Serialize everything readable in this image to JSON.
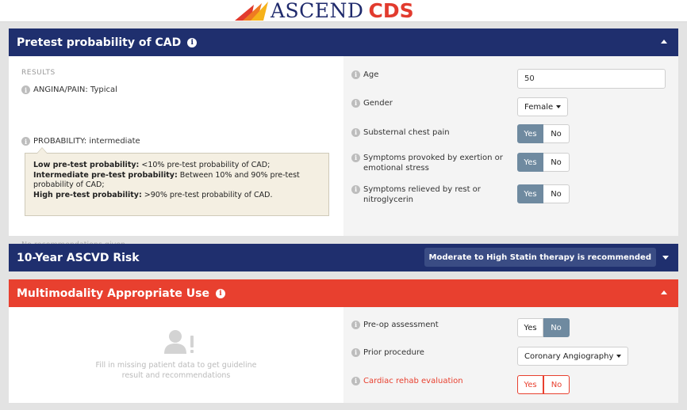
{
  "brand": {
    "wordmark": "ASCEND",
    "suffix": "CDS",
    "colors": {
      "navy": "#1f2a6c",
      "red": "#e23b2e"
    }
  },
  "pretest": {
    "title": "Pretest probability of CAD",
    "results_label": "RESULTS",
    "angina": "ANGINA/PAIN: Typical",
    "probability": "PROBABILITY: intermediate",
    "tooltip": {
      "low_label": "Low pre-test probability:",
      "low_text": " <10% pre-test probability of CAD;",
      "mid_label": "Intermediate pre-test probability:",
      "mid_text": " Between 10% and 90% pre-test probability of CAD;",
      "high_label": "High pre-test probability:",
      "high_text": " >90% pre-test probability of CAD."
    },
    "no_recommendations": "No recommendations given",
    "fields": {
      "age_label": "Age",
      "age_value": "50",
      "gender_label": "Gender",
      "gender_value": "Female",
      "chest_pain_label": "Substernal chest pain",
      "exertion_label": "Symptoms provoked by exertion or emotional stress",
      "relieved_label": "Symptoms relieved by rest or nitroglycerin",
      "yes": "Yes",
      "no": "No"
    }
  },
  "ascvd": {
    "title": "10-Year ASCVD Risk",
    "badge": "Moderate to High Statin therapy is recommended"
  },
  "multimodality": {
    "title": "Multimodality Appropriate Use",
    "placeholder_text": "Fill in missing patient data to get guideline result and recommendations",
    "fields": {
      "preop_label": "Pre-op assessment",
      "prior_label": "Prior procedure",
      "prior_value": "Coronary Angiography",
      "rehab_label": "Cardiac rehab evaluation",
      "yes": "Yes",
      "no": "No"
    }
  }
}
